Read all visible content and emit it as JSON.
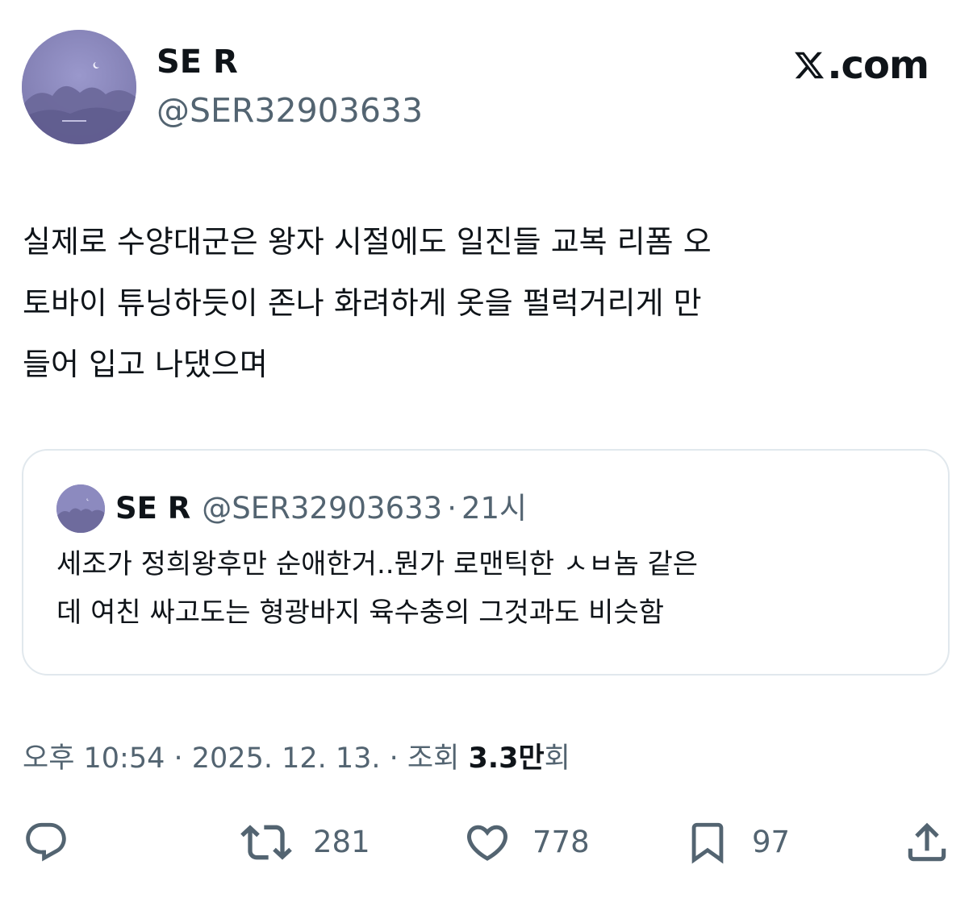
{
  "author": {
    "name": "SE R",
    "handle": "@SER32903633"
  },
  "brand": {
    "text": ".com",
    "icon": "x-logo-icon"
  },
  "tweet": {
    "text": "실제로 수양대군은 왕자 시절에도 일진들 교복 리폼 오\n토바이 튜닝하듯이 존나 화려하게 옷을 펄럭거리게 만\n들어 입고 나댔으며"
  },
  "quote": {
    "name": "SE R",
    "handle": "@SER32903633",
    "separator": "·",
    "time": "21시",
    "text": "세조가 정희왕후만 순애한거..뭔가 로맨틱한 ㅅㅂ놈 같은\n데 여친 싸고도는 형광바지 육수충의 그것과도 비슷함"
  },
  "meta": {
    "datetime": "오후 10:54 · 2025. 12. 13. · 조회 ",
    "views": "3.3만",
    "views_suffix": "회"
  },
  "actions": {
    "reply": {
      "icon": "reply-icon"
    },
    "retweet": {
      "icon": "retweet-icon",
      "count": "281"
    },
    "like": {
      "icon": "heart-icon",
      "count": "778"
    },
    "bookmark": {
      "icon": "bookmark-icon",
      "count": "97"
    },
    "share": {
      "icon": "share-icon"
    }
  },
  "colors": {
    "text": "#0f1419",
    "secondary": "#536471",
    "border": "#e1e8ed",
    "avatar_sky": "#8a87b8"
  }
}
